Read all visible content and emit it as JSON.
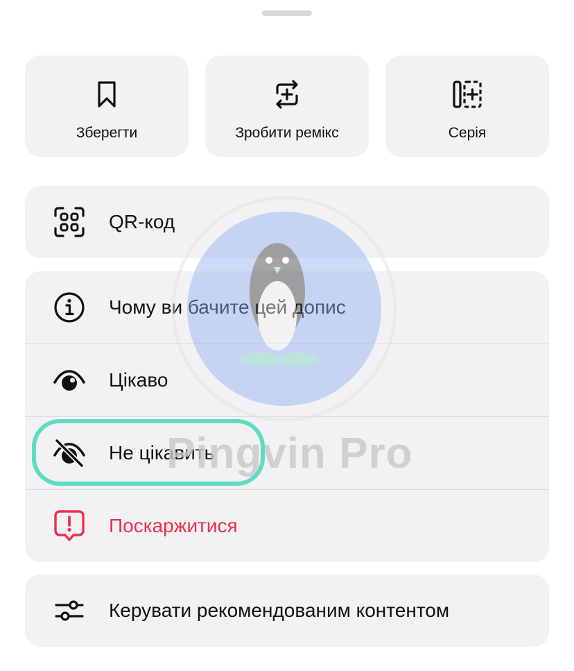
{
  "top_actions": [
    {
      "label": "Зберегти",
      "icon": "bookmark-icon"
    },
    {
      "label": "Зробити ремікс",
      "icon": "remix-icon"
    },
    {
      "label": "Серія",
      "icon": "series-add-icon"
    }
  ],
  "qr": {
    "label": "QR-код",
    "icon": "qr-code-icon"
  },
  "menu": [
    {
      "label": "Чому ви бачите цей допис",
      "icon": "info-icon"
    },
    {
      "label": "Цікаво",
      "icon": "eye-icon"
    },
    {
      "label": "Не цікавить",
      "icon": "eye-off-icon"
    },
    {
      "label": "Поскаржитися",
      "icon": "report-icon"
    }
  ],
  "manage": {
    "label": "Керувати рекомендованим контентом",
    "icon": "sliders-icon"
  },
  "watermark": "Pingvin Pro",
  "colors": {
    "danger": "#ef2e4b",
    "highlight": "#5fdcc0",
    "card_bg": "#f2f2f5"
  }
}
